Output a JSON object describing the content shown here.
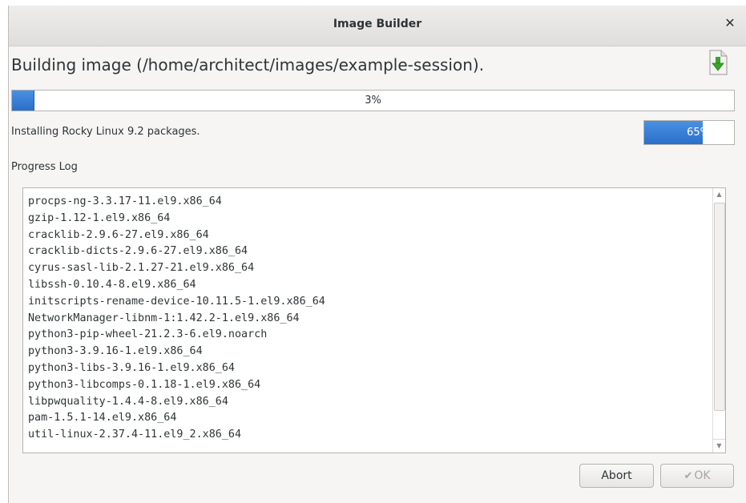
{
  "window": {
    "title": "Image Builder"
  },
  "heading": "Building image (/home/architect/images/example-session).",
  "overall_progress": {
    "value": 0.03,
    "label": "3%"
  },
  "status": {
    "text": "Installing Rocky Linux 9.2 packages.",
    "progress": {
      "value": 0.65,
      "label": "65%"
    }
  },
  "log": {
    "label": "Progress Log",
    "lines": [
      "procps-ng-3.3.17-11.el9.x86_64",
      "gzip-1.12-1.el9.x86_64",
      "cracklib-2.9.6-27.el9.x86_64",
      "cracklib-dicts-2.9.6-27.el9.x86_64",
      "cyrus-sasl-lib-2.1.27-21.el9.x86_64",
      "libssh-0.10.4-8.el9.x86_64",
      "initscripts-rename-device-10.11.5-1.el9.x86_64",
      "NetworkManager-libnm-1:1.42.2-1.el9.x86_64",
      "python3-pip-wheel-21.2.3-6.el9.noarch",
      "python3-3.9.16-1.el9.x86_64",
      "python3-libs-3.9.16-1.el9.x86_64",
      "python3-libcomps-0.1.18-1.el9.x86_64",
      "libpwquality-1.4.4-8.el9.x86_64",
      "pam-1.5.1-14.el9.x86_64",
      "util-linux-2.37.4-11.el9_2.x86_64"
    ]
  },
  "buttons": {
    "abort": "Abort",
    "ok": "OK"
  },
  "icons": {
    "close": "close-icon",
    "download": "download-icon",
    "ok": "ok-icon"
  },
  "colors": {
    "accent": "#3584e4",
    "disabled_text": "#a8a6a3"
  }
}
